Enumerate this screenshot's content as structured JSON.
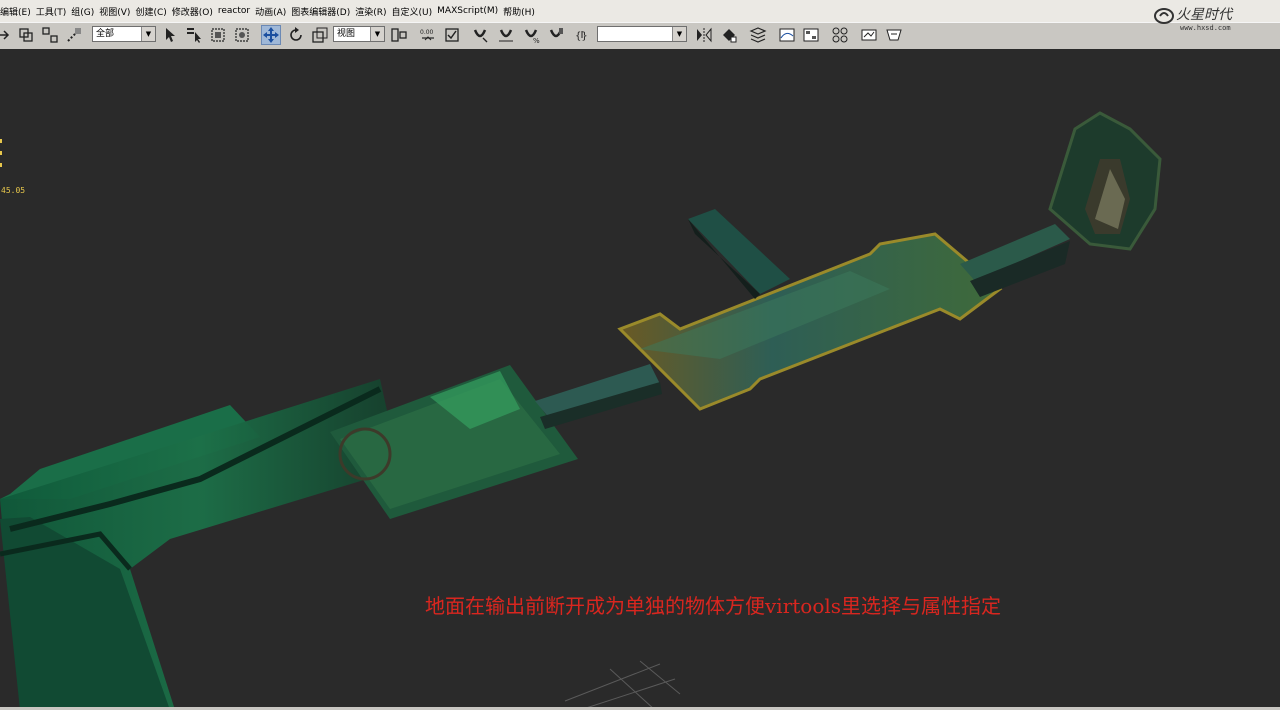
{
  "menu": {
    "items": [
      "编辑(E)",
      "工具(T)",
      "组(G)",
      "视图(V)",
      "创建(C)",
      "修改器(O)",
      "reactor",
      "动画(A)",
      "图表编辑器(D)",
      "渲染(R)",
      "自定义(U)",
      "MAXScript(M)",
      "帮助(H)"
    ]
  },
  "logo": {
    "name": "火星时代",
    "url_text": "www.hxsd.com"
  },
  "toolbar": {
    "selection_filter": "全部",
    "reference_coord": "视图",
    "named_selection": "",
    "spinner_snap_value": "0.00"
  },
  "viewport": {
    "caption": "地面在输出前断开成为单独的物体方便virtools里选择与属性指定",
    "coord_readout": "45.05",
    "caption_color": "#d9261f"
  },
  "colors": {
    "menubar_bg": "#ebe9e4",
    "toolbar_bg": "#c9c7c2",
    "viewport_bg": "#2a2a2a",
    "active_tool": "#9fb8d8"
  }
}
